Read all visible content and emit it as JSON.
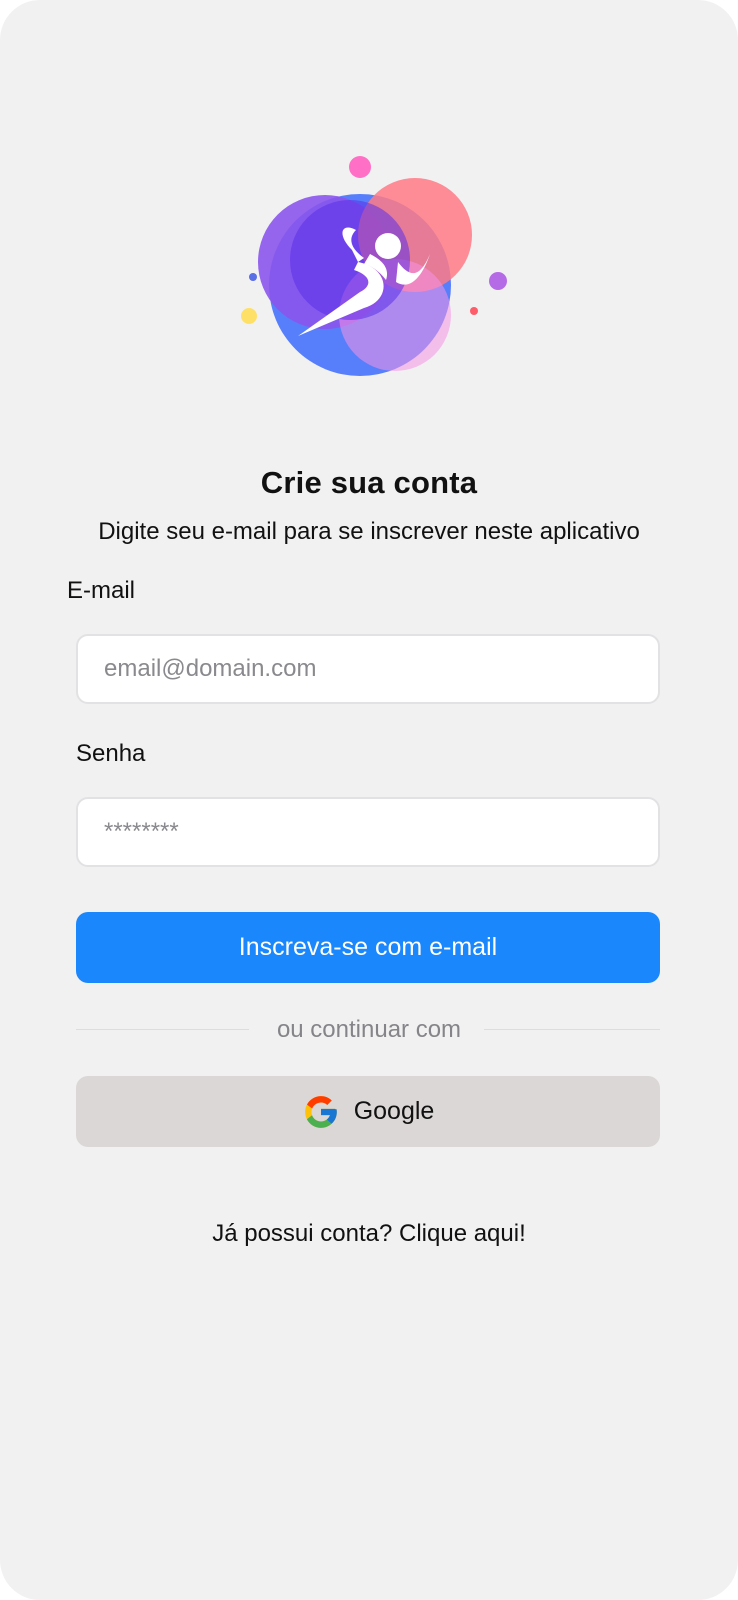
{
  "header": {
    "title": "Crie sua conta",
    "subtitle": "Digite seu e-mail para se inscrever neste aplicativo"
  },
  "logo": {
    "icon": "runner-icon"
  },
  "form": {
    "email_label": "E-mail",
    "email_placeholder": "email@domain.com",
    "email_value": "",
    "password_label": "Senha",
    "password_placeholder": "********",
    "password_value": "",
    "submit_label": "Inscreva-se com e-mail"
  },
  "divider": {
    "text": "ou continuar com"
  },
  "social": {
    "google_label": "Google",
    "google_icon": "google-icon"
  },
  "footer": {
    "login_text": "Já possui conta? Clique aqui!"
  },
  "colors": {
    "background": "#f1f1f2",
    "primary": "#1a87fd",
    "google_button": "#dcd7d7",
    "input_border": "#e2e2e4"
  }
}
